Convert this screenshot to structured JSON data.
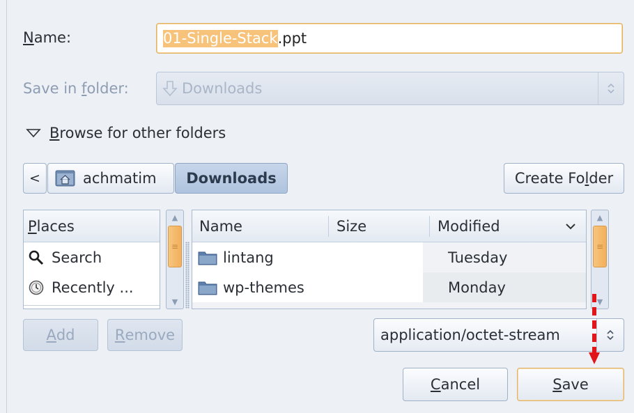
{
  "name_label_prefix": "",
  "name_label_accel": "N",
  "name_label_rest": "ame:",
  "filename_selected": "01-Single-Stack",
  "filename_ext": ".ppt",
  "save_in_label_pre": "Save in ",
  "save_in_label_accel": "f",
  "save_in_label_post": "older:",
  "save_in_value": "Downloads",
  "browse_accel": "B",
  "browse_rest": "rowse for other folders",
  "breadcrumb": {
    "back": "<",
    "home": "achmatim",
    "current": "Downloads"
  },
  "create_folder_pre": "Create Fo",
  "create_folder_accel": "l",
  "create_folder_post": "der",
  "places": {
    "header_accel": "P",
    "header_rest": "laces",
    "items": [
      {
        "label": "Search",
        "icon": "search-icon"
      },
      {
        "label": "Recently ...",
        "icon": "recent-icon"
      }
    ]
  },
  "files": {
    "columns": {
      "name": "Name",
      "size": "Size",
      "modified": "Modified"
    },
    "rows": [
      {
        "name": "lintang",
        "size": "",
        "modified": "Tuesday"
      },
      {
        "name": "wp-themes",
        "size": "",
        "modified": "Monday"
      }
    ]
  },
  "add_accel": "A",
  "add_rest": "dd",
  "remove_accel": "R",
  "remove_rest": "emove",
  "filter_value": "application/octet-stream",
  "cancel_accel": "C",
  "cancel_rest": "ancel",
  "save_accel": "S",
  "save_rest": "ave",
  "colors": {
    "selection": "#f7c27a",
    "accent_border": "#e0b060",
    "annotation": "#e0161a"
  }
}
